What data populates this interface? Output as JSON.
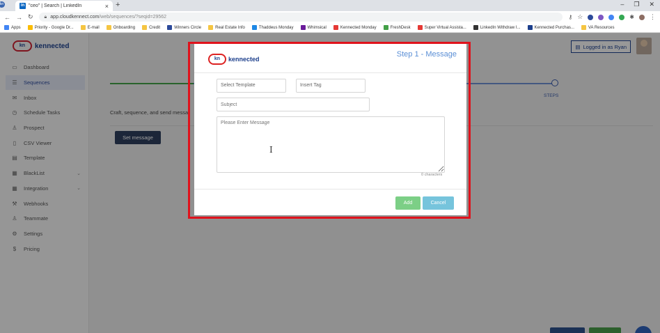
{
  "browser": {
    "tab_title": "\"ceo\" | Search | LinkedIn",
    "url_domain": "app.cloudkennect.com",
    "url_path": "/web/sequences/?seqid=29562",
    "bookmarks": [
      {
        "label": "Apps",
        "color": "#4285f4"
      },
      {
        "label": "Priority - Google Dr...",
        "color": "#fbbc04"
      },
      {
        "label": "E-mail",
        "color": "#f5c542"
      },
      {
        "label": "Onboarding",
        "color": "#f5c542"
      },
      {
        "label": "Credit",
        "color": "#f5c542"
      },
      {
        "label": "Winners Circle",
        "color": "#2c4a9a"
      },
      {
        "label": "Real Estate Info",
        "color": "#f5c542"
      },
      {
        "label": "Thaddeus Monday",
        "color": "#1e88e5"
      },
      {
        "label": "Whimsical",
        "color": "#6a1b9a"
      },
      {
        "label": "Kennected Monday",
        "color": "#e53935"
      },
      {
        "label": "FreshDesk",
        "color": "#43a047"
      },
      {
        "label": "Super Virtual Assista...",
        "color": "#e53935"
      },
      {
        "label": "LinkedIn Withdraw I...",
        "color": "#333333"
      },
      {
        "label": "Kennected Purchas...",
        "color": "#1c3f8c"
      },
      {
        "label": "VA Resources",
        "color": "#f5c542"
      }
    ]
  },
  "sidebar": {
    "brand": "kennected",
    "brand_logo": "kn",
    "items": [
      {
        "label": "Dashboard",
        "icon": "monitor-icon",
        "glyph": "▭"
      },
      {
        "label": "Sequences",
        "icon": "list-icon",
        "glyph": "☰"
      },
      {
        "label": "Inbox",
        "icon": "inbox-icon",
        "glyph": "✉"
      },
      {
        "label": "Schedule Tasks",
        "icon": "clock-icon",
        "glyph": "◷"
      },
      {
        "label": "Prospect",
        "icon": "users-icon",
        "glyph": "♙"
      },
      {
        "label": "CSV Viewer",
        "icon": "file-icon",
        "glyph": "▯"
      },
      {
        "label": "Template",
        "icon": "template-icon",
        "glyph": "▤"
      },
      {
        "label": "BlackList",
        "icon": "blacklist-icon",
        "glyph": "▦"
      },
      {
        "label": "Integration",
        "icon": "integration-icon",
        "glyph": "▦"
      },
      {
        "label": "Webhooks",
        "icon": "webhook-icon",
        "glyph": "⚒"
      },
      {
        "label": "Teammate",
        "icon": "teammate-icon",
        "glyph": "♙"
      },
      {
        "label": "Settings",
        "icon": "gear-icon",
        "glyph": "⚙"
      },
      {
        "label": "Pricing",
        "icon": "dollar-icon",
        "glyph": "$"
      }
    ]
  },
  "header": {
    "logged_in": "Logged in as Ryan"
  },
  "main": {
    "steps_label": "STEPS",
    "description": "Craft, sequence, and send messa",
    "set_message_label": "Set message"
  },
  "modal": {
    "logo": "kn",
    "brand": "kennected",
    "title": "Step 1 - Message",
    "select_template": "Select Template",
    "insert_tag": "Insert Tag",
    "subject_placeholder": "Subject",
    "message_placeholder": "Please Enter Message",
    "char_count": "0 characters",
    "add_label": "Add",
    "cancel_label": "Cancel"
  }
}
